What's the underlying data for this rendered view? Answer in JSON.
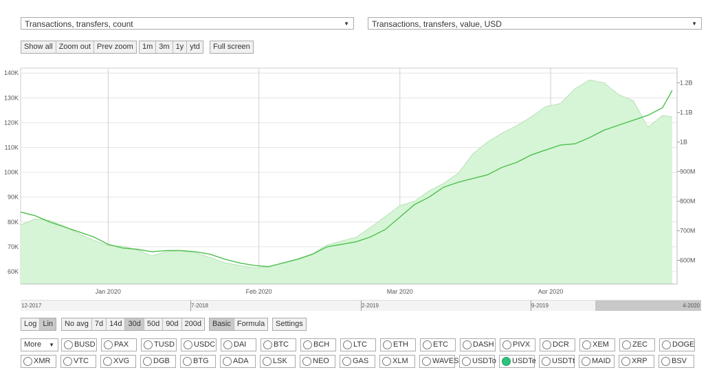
{
  "selects": {
    "left": "Transactions, transfers, count",
    "right": "Transactions, transfers, value, USD"
  },
  "zoom_buttons": [
    "Show all",
    "Zoom out",
    "Prev zoom"
  ],
  "range_buttons": [
    "1m",
    "3m",
    "1y",
    "ytd"
  ],
  "fullscreen_label": "Full screen",
  "scale_buttons": [
    "Log",
    "Lin"
  ],
  "scale_active": "Lin",
  "avg_buttons": [
    "No avg",
    "7d",
    "14d",
    "30d",
    "50d",
    "90d",
    "200d"
  ],
  "avg_active": "30d",
  "mode_buttons": [
    "Basic",
    "Formula"
  ],
  "mode_active": "Basic",
  "settings_label": "Settings",
  "more_label": "More",
  "coins_row1": [
    "BUSD",
    "PAX",
    "TUSD",
    "USDC",
    "DAI",
    "BTC",
    "BCH",
    "LTC",
    "ETH",
    "ETC",
    "DASH",
    "PIVX",
    "DCR",
    "XEM",
    "ZEC",
    "DOGE"
  ],
  "coins_row2": [
    "XMR",
    "VTC",
    "XVG",
    "DGB",
    "BTG",
    "ADA",
    "LSK",
    "NEO",
    "GAS",
    "XLM",
    "WAVES",
    "USDTo",
    "USDTe",
    "USDTt",
    "MAID",
    "XRP",
    "BSV"
  ],
  "selected_coin": "USDTe",
  "navigator_labels": [
    "12-2017",
    "7-2018",
    "2-2019",
    "9-2019",
    "4-2020"
  ],
  "chart_data": {
    "type": "line",
    "x_tick_labels": [
      "Jan 2020",
      "Feb 2020",
      "Mar 2020",
      "Apr 2020"
    ],
    "y_left": {
      "ticks": [
        "60K",
        "70K",
        "80K",
        "90K",
        "100K",
        "110K",
        "120K",
        "130K",
        "140K"
      ],
      "min": 55000,
      "max": 142000
    },
    "y_right": {
      "ticks": [
        "600M",
        "700M",
        "800M",
        "900M",
        "1B",
        "1.1B",
        "1.2B"
      ],
      "min": 520000000,
      "max": 1250000000
    },
    "x_range": [
      "2019-12-14",
      "2020-04-27"
    ],
    "grid": true,
    "colors": {
      "line": "#4cbf4c",
      "area_fill": "#d6f5d6",
      "area_stroke": "#9ed69e"
    },
    "series": [
      {
        "axis": "left",
        "style": "line",
        "x": [
          "2019-12-14",
          "2019-12-17",
          "2019-12-20",
          "2019-12-23",
          "2019-12-26",
          "2019-12-29",
          "2020-01-01",
          "2020-01-04",
          "2020-01-07",
          "2020-01-10",
          "2020-01-13",
          "2020-01-16",
          "2020-01-19",
          "2020-01-22",
          "2020-01-25",
          "2020-01-28",
          "2020-01-31",
          "2020-02-03",
          "2020-02-06",
          "2020-02-09",
          "2020-02-12",
          "2020-02-15",
          "2020-02-18",
          "2020-02-21",
          "2020-02-24",
          "2020-02-27",
          "2020-03-01",
          "2020-03-04",
          "2020-03-07",
          "2020-03-10",
          "2020-03-13",
          "2020-03-16",
          "2020-03-19",
          "2020-03-22",
          "2020-03-25",
          "2020-03-28",
          "2020-03-31",
          "2020-04-03",
          "2020-04-06",
          "2020-04-09",
          "2020-04-12",
          "2020-04-15",
          "2020-04-18",
          "2020-04-21",
          "2020-04-24",
          "2020-04-26"
        ],
        "y": [
          84000,
          82500,
          80000,
          78000,
          76000,
          74000,
          71000,
          69500,
          69000,
          68000,
          68500,
          68500,
          68000,
          67000,
          65000,
          63500,
          62500,
          62000,
          63500,
          65000,
          67000,
          70000,
          71000,
          72000,
          74000,
          77000,
          82000,
          87000,
          90000,
          94000,
          96000,
          97500,
          99000,
          102000,
          104000,
          107000,
          109000,
          111000,
          111500,
          114000,
          117000,
          119000,
          121000,
          123000,
          126000,
          133000
        ]
      },
      {
        "axis": "right",
        "style": "area",
        "x": [
          "2019-12-14",
          "2019-12-17",
          "2019-12-20",
          "2019-12-23",
          "2019-12-26",
          "2019-12-29",
          "2020-01-01",
          "2020-01-04",
          "2020-01-07",
          "2020-01-10",
          "2020-01-13",
          "2020-01-16",
          "2020-01-19",
          "2020-01-22",
          "2020-01-25",
          "2020-01-28",
          "2020-01-31",
          "2020-02-03",
          "2020-02-06",
          "2020-02-09",
          "2020-02-12",
          "2020-02-15",
          "2020-02-18",
          "2020-02-21",
          "2020-02-24",
          "2020-02-27",
          "2020-03-01",
          "2020-03-04",
          "2020-03-07",
          "2020-03-10",
          "2020-03-13",
          "2020-03-16",
          "2020-03-19",
          "2020-03-22",
          "2020-03-25",
          "2020-03-28",
          "2020-03-31",
          "2020-04-03",
          "2020-04-06",
          "2020-04-09",
          "2020-04-12",
          "2020-04-15",
          "2020-04-18",
          "2020-04-21",
          "2020-04-24",
          "2020-04-26"
        ],
        "y": [
          720000000,
          740000000,
          735000000,
          715000000,
          690000000,
          668000000,
          650000000,
          648000000,
          635000000,
          615000000,
          630000000,
          632000000,
          625000000,
          610000000,
          592000000,
          583000000,
          575000000,
          578000000,
          592000000,
          605000000,
          622000000,
          652000000,
          665000000,
          678000000,
          712000000,
          748000000,
          785000000,
          800000000,
          835000000,
          860000000,
          895000000,
          960000000,
          1000000000,
          1030000000,
          1055000000,
          1085000000,
          1120000000,
          1130000000,
          1180000000,
          1210000000,
          1200000000,
          1160000000,
          1140000000,
          1050000000,
          1090000000,
          1085000000
        ]
      }
    ]
  }
}
